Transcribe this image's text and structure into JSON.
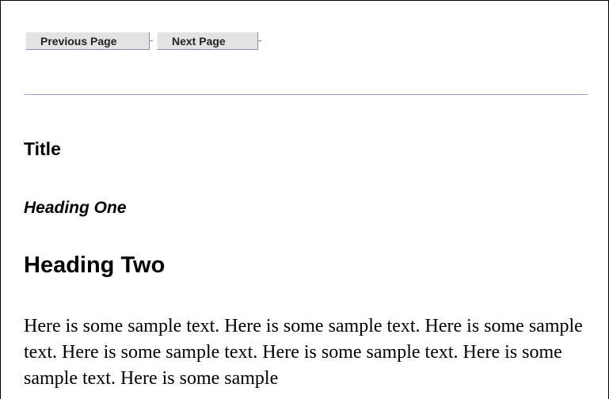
{
  "nav": {
    "previous_label": "Previous Page",
    "next_label": "Next Page"
  },
  "content": {
    "title": "Title",
    "heading_one": "Heading One",
    "heading_two": "Heading Two",
    "body": "Here is some sample text. Here is some sample text. Here is some sample text. Here is some sample text. Here is some sample text. Here is some sample text. Here is some sample"
  }
}
